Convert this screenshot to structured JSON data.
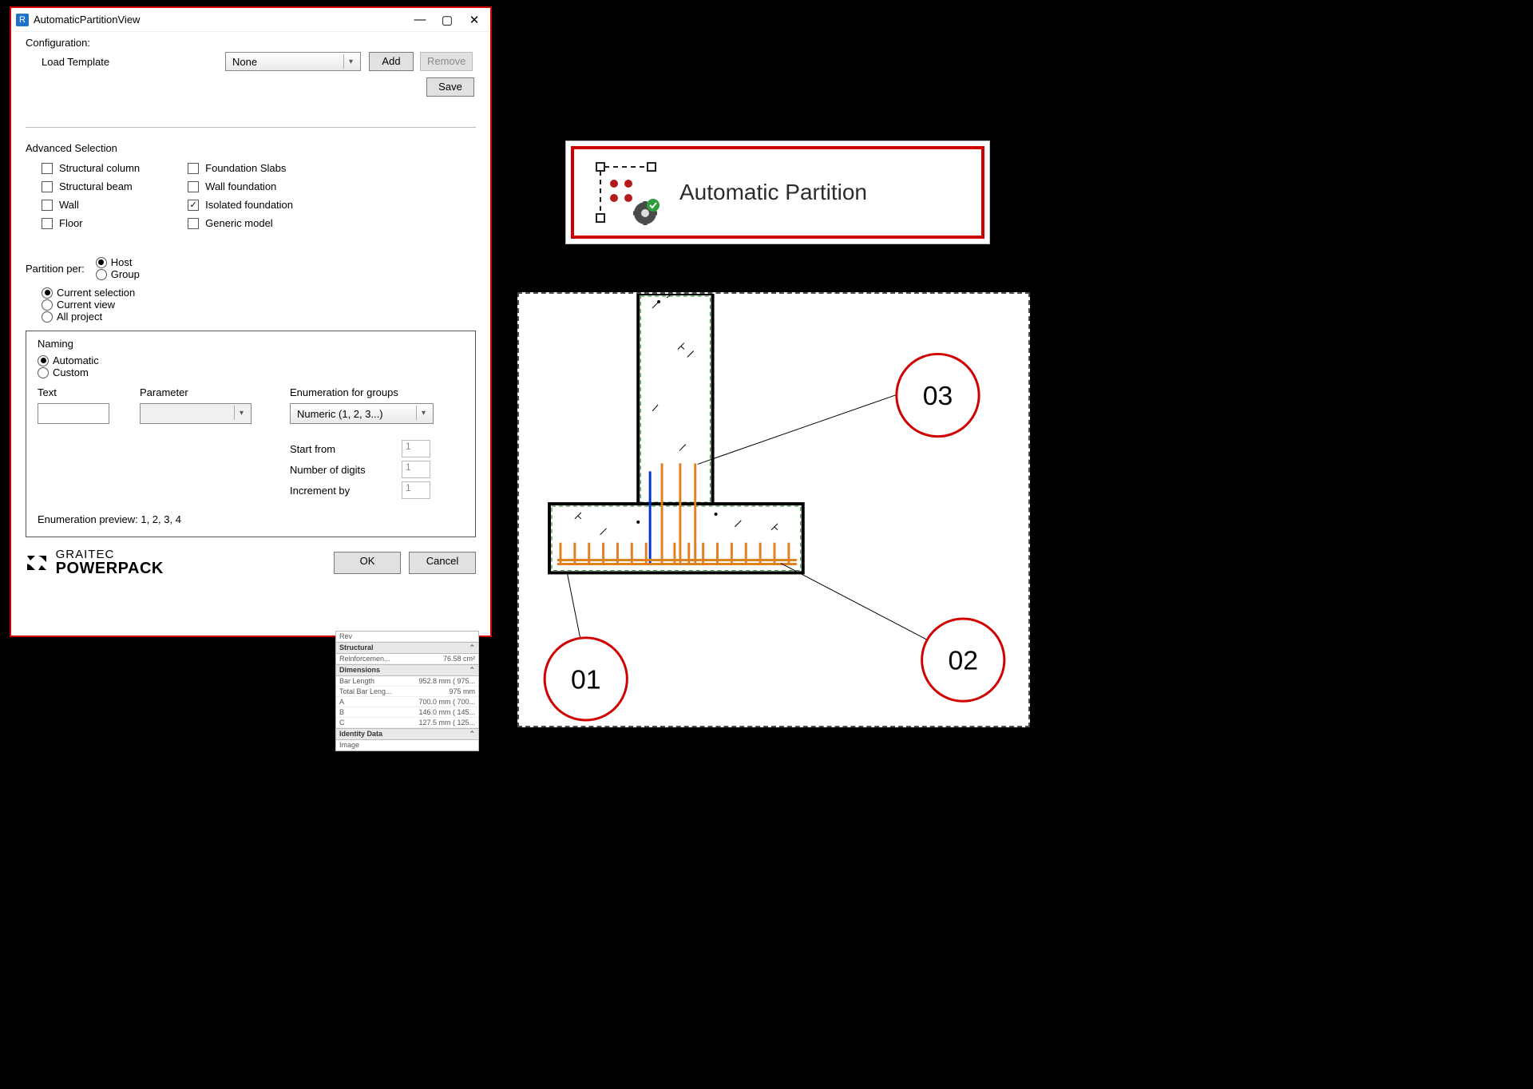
{
  "dialog": {
    "title": "AutomaticPartitionView",
    "config_label": "Configuration:",
    "load_template_label": "Load Template",
    "template_value": "None",
    "btn_add": "Add",
    "btn_remove": "Remove",
    "btn_save": "Save",
    "adv_heading": "Advanced Selection",
    "checks_left": [
      {
        "label": "Structural column",
        "checked": false
      },
      {
        "label": "Structural beam",
        "checked": false
      },
      {
        "label": "Wall",
        "checked": false
      },
      {
        "label": "Floor",
        "checked": false
      }
    ],
    "checks_right": [
      {
        "label": "Foundation Slabs",
        "checked": false
      },
      {
        "label": "Wall foundation",
        "checked": false
      },
      {
        "label": "Isolated foundation",
        "checked": true
      },
      {
        "label": "Generic model",
        "checked": false
      }
    ],
    "partition_label": "Partition per:",
    "partition_opts": [
      "Host",
      "Group"
    ],
    "partition_sel": "Host",
    "scope_opts": [
      "Current selection",
      "Current view",
      "All project"
    ],
    "scope_sel": "Current selection",
    "naming_heading": "Naming",
    "naming_mode_opts": [
      "Automatic",
      "Custom"
    ],
    "naming_mode_sel": "Automatic",
    "text_label": "Text",
    "param_label": "Parameter",
    "enum_label": "Enumeration for groups",
    "enum_value": "Numeric (1, 2, 3...)",
    "start_from_label": "Start from",
    "start_from_value": "1",
    "digits_label": "Number of digits",
    "digits_value": "1",
    "increment_label": "Increment by",
    "increment_value": "1",
    "preview_label": "Enumeration preview: 1, 2, 3, 4",
    "brand_top": "GRAITEC",
    "brand_big": "POWERPACK",
    "btn_ok": "OK",
    "btn_cancel": "Cancel"
  },
  "tool": {
    "label": "Automatic  Partition"
  },
  "callouts": {
    "c1": "01",
    "c2": "02",
    "c3": "03"
  },
  "props": {
    "top": "Rev",
    "sections": [
      {
        "name": "Structural",
        "rows": [
          {
            "k": "Reinforcemen...",
            "v": "76.58 cm²"
          }
        ]
      },
      {
        "name": "Dimensions",
        "rows": [
          {
            "k": "Bar Length",
            "v": "952.8 mm ( 975..."
          },
          {
            "k": "Total Bar Leng...",
            "v": "975 mm"
          },
          {
            "k": "A",
            "v": "700.0 mm ( 700..."
          },
          {
            "k": "B",
            "v": "146.0 mm ( 145..."
          },
          {
            "k": "C",
            "v": "127.5 mm ( 125..."
          }
        ]
      },
      {
        "name": "Identity Data",
        "rows": [
          {
            "k": "Image",
            "v": ""
          }
        ]
      }
    ]
  }
}
